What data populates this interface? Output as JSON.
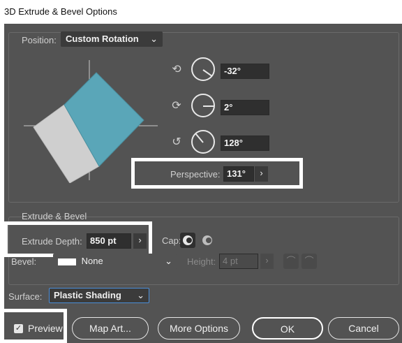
{
  "window": {
    "title": "3D Extrude & Bevel Options"
  },
  "position": {
    "label": "Position:",
    "value": "Custom Rotation",
    "x_rotation": "-32°",
    "y_rotation": "2°",
    "z_rotation": "128°",
    "perspective_label": "Perspective:",
    "perspective_value": "131°"
  },
  "extrude": {
    "section_title": "Extrude & Bevel",
    "depth_label": "Extrude Depth:",
    "depth_value": "850 pt",
    "cap_label": "Cap:",
    "bevel_label": "Bevel:",
    "bevel_value": "None",
    "height_label": "Height:",
    "height_value": "4 pt"
  },
  "surface": {
    "label": "Surface:",
    "value": "Plastic Shading"
  },
  "footer": {
    "preview_label": "Preview",
    "map_art_label": "Map Art...",
    "more_options_label": "More Options",
    "ok_label": "OK",
    "cancel_label": "Cancel"
  },
  "icons": {
    "x_axis": "rotate-x-icon",
    "y_axis": "rotate-y-icon",
    "z_axis": "rotate-z-icon",
    "cap_on": "cap-on-icon",
    "cap_off": "cap-off-icon",
    "bevel_in": "bevel-in-icon",
    "bevel_out": "bevel-out-icon"
  },
  "colors": {
    "cube_face": "#5aa6b8",
    "cube_side": "#cfcfcf",
    "dialog_bg": "#535353"
  }
}
